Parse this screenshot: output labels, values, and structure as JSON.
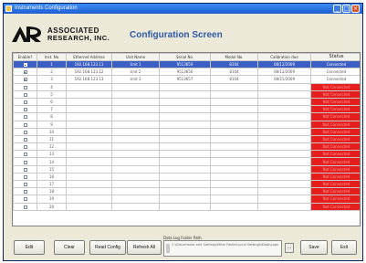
{
  "window": {
    "title": "Instruments Configuration",
    "minimize": "_",
    "maximize": "□",
    "close": "×"
  },
  "logo": {
    "line1": "ASSOCIATED",
    "line2": "RESEARCH, INC."
  },
  "screen_title": "Configuration Screen",
  "table": {
    "headers": [
      "Enable?",
      "Inst. No",
      "Ethernet Address",
      "Unit Name",
      "Serial No.",
      "Model No.",
      "Calibration due",
      "Status"
    ],
    "rows": [
      {
        "enabled": true,
        "no": "1",
        "ip": "192.168.123.11",
        "unit": "Unit 1",
        "serial": "9513659",
        "model": "8104",
        "cal": "08/12/2009",
        "status": "Connected",
        "connected": true
      },
      {
        "enabled": true,
        "no": "2",
        "ip": "192.168.123.12",
        "unit": "Unit 2",
        "serial": "9513656",
        "model": "8104",
        "cal": "08/12/2009",
        "status": "Connected",
        "connected": true
      },
      {
        "enabled": true,
        "no": "3",
        "ip": "192.168.123.13",
        "unit": "Unit 3",
        "serial": "9513657",
        "model": "8104",
        "cal": "08/15/2009",
        "status": "Connected",
        "connected": true
      },
      {
        "enabled": false,
        "no": "4",
        "ip": "",
        "unit": "",
        "serial": "",
        "model": "",
        "cal": "",
        "status": "Not Connected",
        "connected": false
      },
      {
        "enabled": false,
        "no": "5",
        "ip": "",
        "unit": "",
        "serial": "",
        "model": "",
        "cal": "",
        "status": "Not Connected",
        "connected": false
      },
      {
        "enabled": false,
        "no": "6",
        "ip": "",
        "unit": "",
        "serial": "",
        "model": "",
        "cal": "",
        "status": "Not Connected",
        "connected": false
      },
      {
        "enabled": false,
        "no": "7",
        "ip": "",
        "unit": "",
        "serial": "",
        "model": "",
        "cal": "",
        "status": "Not Connected",
        "connected": false
      },
      {
        "enabled": false,
        "no": "8",
        "ip": "",
        "unit": "",
        "serial": "",
        "model": "",
        "cal": "",
        "status": "Not Connected",
        "connected": false
      },
      {
        "enabled": false,
        "no": "9",
        "ip": "",
        "unit": "",
        "serial": "",
        "model": "",
        "cal": "",
        "status": "Not Connected",
        "connected": false
      },
      {
        "enabled": false,
        "no": "10",
        "ip": "",
        "unit": "",
        "serial": "",
        "model": "",
        "cal": "",
        "status": "Not Connected",
        "connected": false
      },
      {
        "enabled": false,
        "no": "11",
        "ip": "",
        "unit": "",
        "serial": "",
        "model": "",
        "cal": "",
        "status": "Not Connected",
        "connected": false
      },
      {
        "enabled": false,
        "no": "12",
        "ip": "",
        "unit": "",
        "serial": "",
        "model": "",
        "cal": "",
        "status": "Not Connected",
        "connected": false
      },
      {
        "enabled": false,
        "no": "13",
        "ip": "",
        "unit": "",
        "serial": "",
        "model": "",
        "cal": "",
        "status": "Not Connected",
        "connected": false
      },
      {
        "enabled": false,
        "no": "14",
        "ip": "",
        "unit": "",
        "serial": "",
        "model": "",
        "cal": "",
        "status": "Not Connected",
        "connected": false
      },
      {
        "enabled": false,
        "no": "15",
        "ip": "",
        "unit": "",
        "serial": "",
        "model": "",
        "cal": "",
        "status": "Not Connected",
        "connected": false
      },
      {
        "enabled": false,
        "no": "16",
        "ip": "",
        "unit": "",
        "serial": "",
        "model": "",
        "cal": "",
        "status": "Not Connected",
        "connected": false
      },
      {
        "enabled": false,
        "no": "17",
        "ip": "",
        "unit": "",
        "serial": "",
        "model": "",
        "cal": "",
        "status": "Not Connected",
        "connected": false
      },
      {
        "enabled": false,
        "no": "18",
        "ip": "",
        "unit": "",
        "serial": "",
        "model": "",
        "cal": "",
        "status": "Not Connected",
        "connected": false
      },
      {
        "enabled": false,
        "no": "19",
        "ip": "",
        "unit": "",
        "serial": "",
        "model": "",
        "cal": "",
        "status": "Not Connected",
        "connected": false
      },
      {
        "enabled": false,
        "no": "20",
        "ip": "",
        "unit": "",
        "serial": "",
        "model": "",
        "cal": "",
        "status": "Not Connected",
        "connected": false
      }
    ]
  },
  "buttons": {
    "edit": "Edit",
    "clear": "Clear",
    "read_config": "Read Config",
    "refresh_all": "Refresh All",
    "save": "Save",
    "exit": "Exit",
    "browse": "..."
  },
  "path": {
    "label": "Data Log Folder Path",
    "value": "C:\\Documents and Settings\\Main Folder\\Local Settings\\Data\\Logs"
  },
  "colors": {
    "selected_row": "#3b5fc4",
    "not_connected": "#e61e1e",
    "title_blue": "#2e5aa8"
  }
}
